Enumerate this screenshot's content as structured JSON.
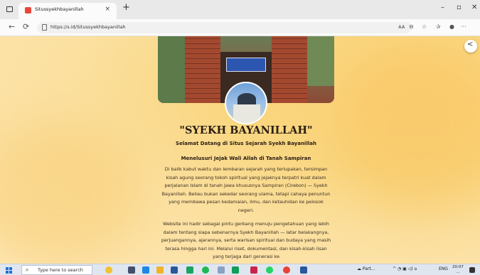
{
  "browser": {
    "tab_title": "Situssyekhbayanillah",
    "url": "https://s.id/Situssyekhbayanillah",
    "close_glyph": "×",
    "newtab_glyph": "+",
    "min_glyph": "–",
    "max_glyph": "▫",
    "winclose_glyph": "✕",
    "back_glyph": "←",
    "reload_glyph": "⟳",
    "read_aloud": "Aᴀ",
    "more_glyph": "···"
  },
  "page": {
    "share_glyph": "<",
    "heading": "\"SYEKH BAYANILLAH\"",
    "welcome": "Selamat Datang di Situs Sejarah Syekh Bayanillah",
    "tagline": "Menelusuri Jejak Wali Allah di Tanah Sampiran",
    "paragraph1": "Di balik kabut waktu dan lembaran sejarah yang terlupakan, tersimpan kisah agung seorang tokoh spiritual yang jejaknya terpatri kuat dalam perjalanan Islam di tanah Jawa khususnya Sampiran (Cirebon) — Syekh Bayanillah. Beliau bukan sekedar seorang ulama, tetapi cahaya penuntun yang membawa pesan kedamaian, ilmu, dan ketauhidan ke pelosok negeri.",
    "paragraph2": "Website ini hadir sebagai pintu gerbang menuju pengetahuan yang lebih dalam tentang siapa sebenarnya Syekh Bayanillah — latar belakangnya, perjuangannya, ajarannya, serta warisan spiritual dan budaya yang masih terasa hingga hari ini. Melalui riset, dokumentasi, dan kisah-kisah lisan yang terjaga dari generasi ke"
  },
  "taskbar": {
    "search_placeholder": "Type here to search",
    "weather": "Part...",
    "lang": "ENG",
    "time": "20:07",
    "date": "..."
  }
}
